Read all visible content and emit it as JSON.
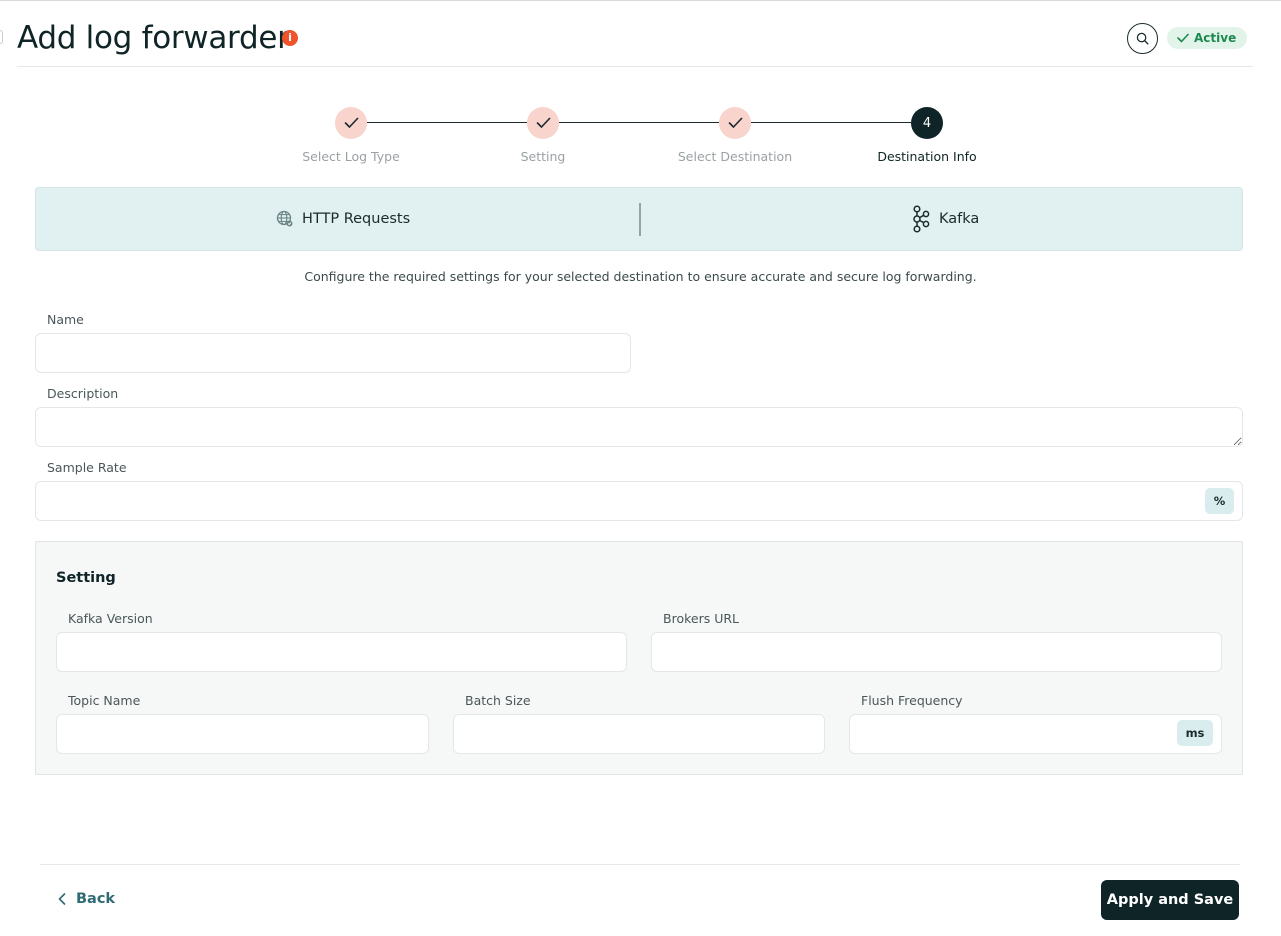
{
  "header": {
    "title": "Add log forwarder",
    "info_badge": "i",
    "status": "Active"
  },
  "stepper": {
    "steps": [
      {
        "label": "Select Log Type",
        "state": "done"
      },
      {
        "label": "Setting",
        "state": "done"
      },
      {
        "label": "Select Destination",
        "state": "done"
      },
      {
        "label": "Destination Info",
        "state": "active",
        "number": "4"
      }
    ]
  },
  "destination": {
    "source": {
      "label": "HTTP Requests",
      "icon": "globe-network-icon"
    },
    "target": {
      "label": "Kafka",
      "icon": "kafka-icon"
    }
  },
  "helper_text": "Configure the required settings for your selected destination to ensure accurate and secure log forwarding.",
  "form": {
    "name": {
      "label": "Name",
      "value": "",
      "placeholder": ""
    },
    "description": {
      "label": "Description",
      "value": "",
      "placeholder": ""
    },
    "sample_rate": {
      "label": "Sample Rate",
      "value": "",
      "placeholder": "",
      "suffix": "%"
    }
  },
  "setting": {
    "title": "Setting",
    "kafka_version": {
      "label": "Kafka Version",
      "value": "",
      "placeholder": ""
    },
    "brokers_url": {
      "label": "Brokers URL",
      "value": "",
      "placeholder": ""
    },
    "topic_name": {
      "label": "Topic Name",
      "value": "",
      "placeholder": ""
    },
    "batch_size": {
      "label": "Batch Size",
      "value": "",
      "placeholder": ""
    },
    "flush_frequency": {
      "label": "Flush Frequency",
      "value": "",
      "placeholder": "",
      "suffix": "ms"
    }
  },
  "footer": {
    "back_label": "Back",
    "apply_label": "Apply and Save"
  },
  "colors": {
    "primary_dark": "#0e2426",
    "step_done": "#f8d4cc",
    "accent_teal": "#2f6b73",
    "status_green": "#1c8a4f",
    "info_red": "#f0542d"
  }
}
